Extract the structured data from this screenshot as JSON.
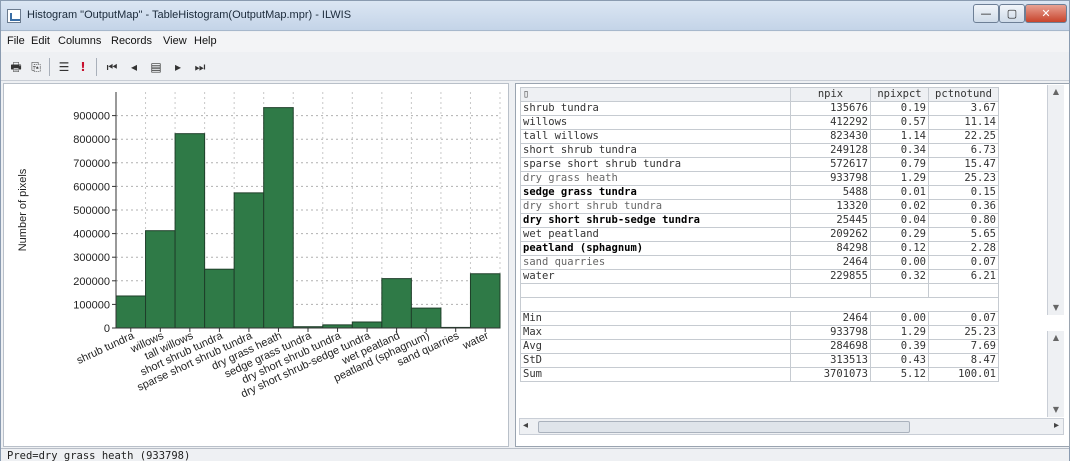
{
  "window": {
    "title": "Histogram \"OutputMap\" - TableHistogram(OutputMap.mpr) - ILWIS",
    "minimize_label": "—",
    "maximize_label": "▢",
    "close_label": "✕"
  },
  "menu": [
    "File",
    "Edit",
    "Columns",
    "Records",
    "View",
    "Help"
  ],
  "toolbar": {
    "icons": [
      "print-icon",
      "copy-icon",
      "properties-icon",
      "exclamation-icon",
      "first-record-icon",
      "previous-record-icon",
      "go-to-record-icon",
      "next-record-icon",
      "last-record-icon"
    ],
    "glyphs": [
      "🖶",
      "⎘",
      "☰",
      "!",
      "⏮",
      "◂",
      "▤",
      "▸",
      "⏭"
    ]
  },
  "chart_data": {
    "type": "bar",
    "ylabel": "Number of pixels",
    "xlabel": "",
    "ylim": [
      0,
      1000000
    ],
    "yticks": [
      0,
      100000,
      200000,
      300000,
      400000,
      500000,
      600000,
      700000,
      800000,
      900000
    ],
    "grid": true,
    "bar_color": "#2f7a47",
    "categories": [
      "shrub tundra",
      "willows",
      "tall willows",
      "short shrub tundra",
      "sparse short shrub tundra",
      "dry grass heath",
      "sedge grass tundra",
      "dry short shrub tundra",
      "dry short shrub-sedge tundra",
      "wet peatland",
      "peatland (sphagnum)",
      "sand quarries",
      "water"
    ],
    "values": [
      135676,
      412292,
      823430,
      249128,
      572617,
      933798,
      5488,
      13320,
      25445,
      209262,
      84298,
      2464,
      229855
    ]
  },
  "table": {
    "header": [
      "",
      "npix",
      "npixpct",
      "pctnotund"
    ],
    "rows": [
      {
        "name": "shrub tundra",
        "npix": "135676",
        "npixpct": "0.19",
        "pctnotund": "3.67",
        "style": "normal"
      },
      {
        "name": "willows",
        "npix": "412292",
        "npixpct": "0.57",
        "pctnotund": "11.14",
        "style": "normal"
      },
      {
        "name": "tall willows",
        "npix": "823430",
        "npixpct": "1.14",
        "pctnotund": "22.25",
        "style": "normal"
      },
      {
        "name": "short shrub tundra",
        "npix": "249128",
        "npixpct": "0.34",
        "pctnotund": "6.73",
        "style": "normal"
      },
      {
        "name": "sparse short shrub tundra",
        "npix": "572617",
        "npixpct": "0.79",
        "pctnotund": "15.47",
        "style": "normal"
      },
      {
        "name": "dry grass heath",
        "npix": "933798",
        "npixpct": "1.29",
        "pctnotund": "25.23",
        "style": "dim"
      },
      {
        "name": "sedge grass tundra",
        "npix": "5488",
        "npixpct": "0.01",
        "pctnotund": "0.15",
        "style": "bold"
      },
      {
        "name": "dry short shrub tundra",
        "npix": "13320",
        "npixpct": "0.02",
        "pctnotund": "0.36",
        "style": "dim"
      },
      {
        "name": "dry short shrub-sedge tundra",
        "npix": "25445",
        "npixpct": "0.04",
        "pctnotund": "0.80",
        "style": "bold"
      },
      {
        "name": "wet peatland",
        "npix": "209262",
        "npixpct": "0.29",
        "pctnotund": "5.65",
        "style": "normal"
      },
      {
        "name": "peatland (sphagnum)",
        "npix": "84298",
        "npixpct": "0.12",
        "pctnotund": "2.28",
        "style": "bold"
      },
      {
        "name": "sand quarries",
        "npix": "2464",
        "npixpct": "0.00",
        "pctnotund": "0.07",
        "style": "dim"
      },
      {
        "name": "water",
        "npix": "229855",
        "npixpct": "0.32",
        "pctnotund": "6.21",
        "style": "normal"
      }
    ],
    "stats": [
      {
        "name": "Min",
        "npix": "2464",
        "npixpct": "0.00",
        "pctnotund": "0.07"
      },
      {
        "name": "Max",
        "npix": "933798",
        "npixpct": "1.29",
        "pctnotund": "25.23"
      },
      {
        "name": "Avg",
        "npix": "284698",
        "npixpct": "0.39",
        "pctnotund": "7.69"
      },
      {
        "name": "StD",
        "npix": "313513",
        "npixpct": "0.43",
        "pctnotund": "8.47"
      },
      {
        "name": "Sum",
        "npix": "3701073",
        "npixpct": "5.12",
        "pctnotund": "100.01"
      }
    ]
  },
  "status": "Pred=dry grass heath (933798)"
}
